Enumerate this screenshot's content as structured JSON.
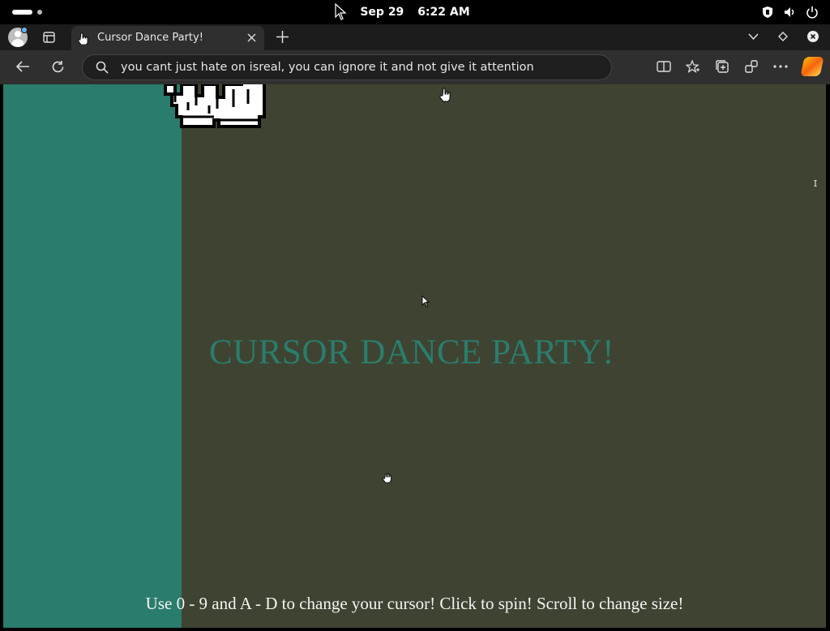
{
  "os": {
    "date": "Sep 29",
    "time": "6:22 AM",
    "tray_icons": [
      "shield-icon",
      "speaker-icon",
      "power-icon"
    ]
  },
  "browser": {
    "tab": {
      "title": "Cursor Dance Party!",
      "favicon": "hand-pointer-icon"
    },
    "address_bar": {
      "value": "you cant just hate on isreal, you can ignore it and not give it attention"
    },
    "toolbar_icons": [
      "back-icon",
      "refresh-icon",
      "split-screen-icon",
      "favorites-icon",
      "collections-icon",
      "extensions-icon",
      "more-icon",
      "copilot-icon"
    ]
  },
  "page": {
    "title": "CURSOR DANCE PARTY!",
    "instructions": "Use 0 - 9 and A - D to change your cursor! Click to spin! Scroll to change size!",
    "colors": {
      "background": "#3f4432",
      "sidebar": "#2a7d6d",
      "title": "#2a7d6d",
      "instructions": "#f4f4f4"
    }
  }
}
